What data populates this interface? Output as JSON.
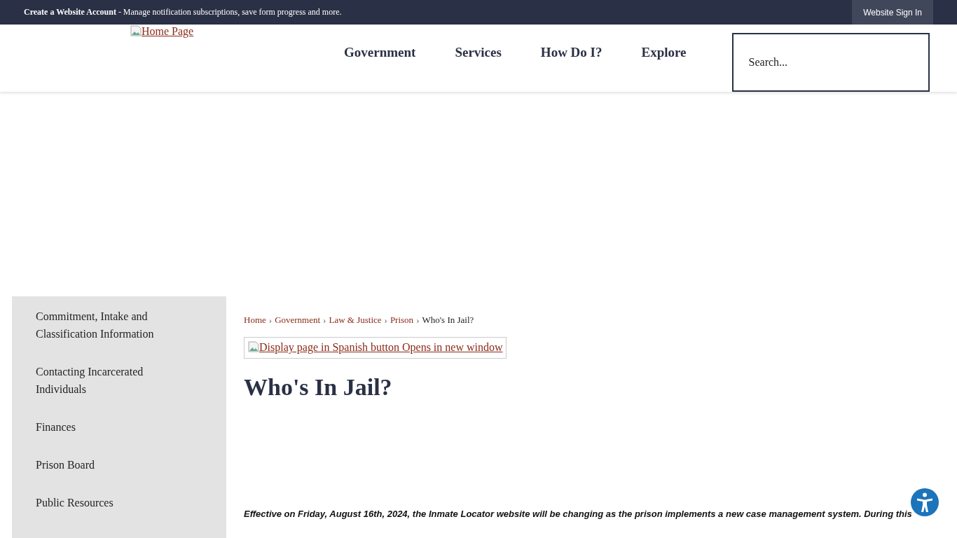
{
  "top_bar": {
    "account_link": "Create a Website Account",
    "account_note": " - Manage notification subscriptions, save form progress and more.",
    "sign_in": "Website Sign In"
  },
  "header": {
    "logo_alt": "Home Page",
    "nav": [
      {
        "label": "Government"
      },
      {
        "label": "Services"
      },
      {
        "label": "How Do I?"
      },
      {
        "label": "Explore"
      }
    ],
    "search": {
      "placeholder": "Search..."
    }
  },
  "sidebar": {
    "items": [
      {
        "label": "Commitment, Intake and Classification Information"
      },
      {
        "label": "Contacting Incarcerated Individuals"
      },
      {
        "label": "Finances"
      },
      {
        "label": "Prison Board"
      },
      {
        "label": "Public Resources"
      }
    ]
  },
  "breadcrumb": [
    {
      "label": "Home",
      "kind": "link"
    },
    {
      "label": "Government",
      "kind": "link",
      "separator": "›"
    },
    {
      "label": "Law & Justice",
      "kind": "link",
      "separator": "›"
    },
    {
      "label": "Prison",
      "kind": "link",
      "separator": "›"
    },
    {
      "label": "Who's In Jail?",
      "kind": "current",
      "separator": "›"
    }
  ],
  "translate_alt": "Display page in Spanish button Opens in new window",
  "title": "Who's In Jail?",
  "notice": "Effective on Friday, August 16th, 2024, the Inmate Locator website will be changing as the prison implements a new case management system. During this"
}
